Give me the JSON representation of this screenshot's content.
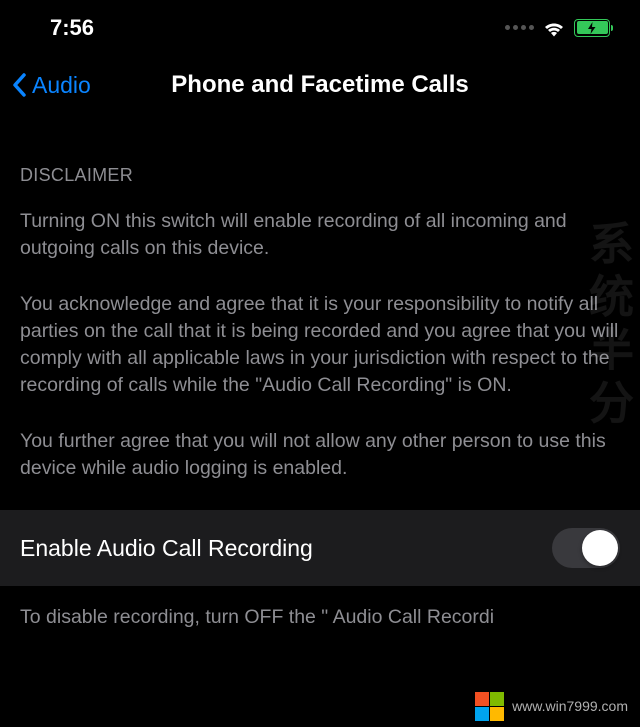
{
  "statusBar": {
    "time": "7:56"
  },
  "nav": {
    "backLabel": "Audio",
    "title": "Phone and Facetime Calls"
  },
  "disclaimer": {
    "header": "DISCLAIMER",
    "p1": "Turning ON this switch will enable recording of all incoming and outgoing calls on this device.",
    "p2": "You acknowledge and agree that it is your responsibility to notify all parties on the call that it is being recorded and you agree that you will comply with all applicable laws in your jurisdiction with respect to the recording of calls while the \"Audio Call Recording\" is ON.",
    "p3": "You further agree that you will not allow any other person to use this device while audio logging is enabled."
  },
  "setting": {
    "label": "Enable Audio Call Recording",
    "footer": "To disable recording, turn OFF the \" Audio Call Recordi"
  },
  "watermark": {
    "side": "系统半分",
    "url": "www.win7999.com"
  }
}
